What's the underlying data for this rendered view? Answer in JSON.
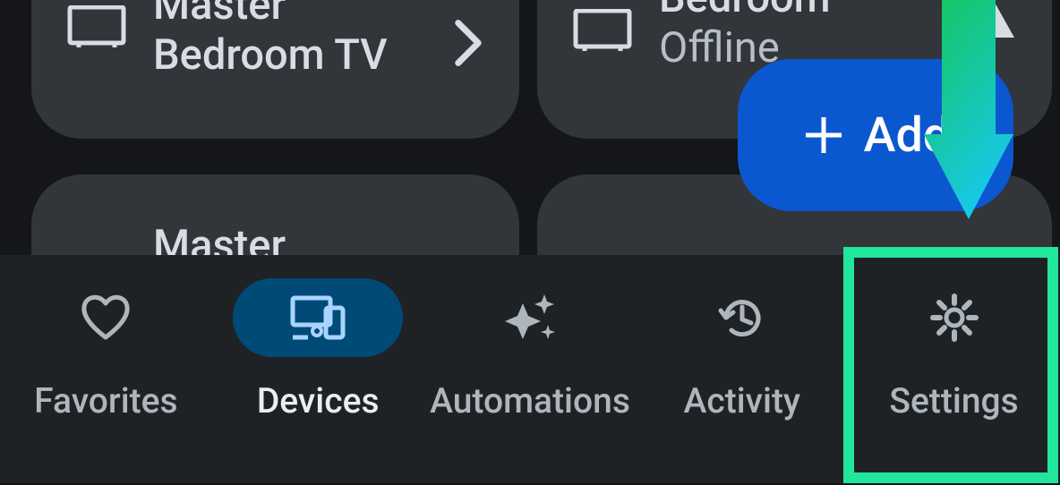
{
  "devices": {
    "card1": {
      "name_line1": "Master",
      "name_line2": "Bedroom TV"
    },
    "card2": {
      "name_line1": "Bedroom",
      "status": "Offline"
    },
    "card3": {
      "name_line1": "Master"
    }
  },
  "fab": {
    "label": "Add"
  },
  "nav": {
    "favorites": "Favorites",
    "devices": "Devices",
    "automations": "Automations",
    "activity": "Activity",
    "settings": "Settings"
  }
}
